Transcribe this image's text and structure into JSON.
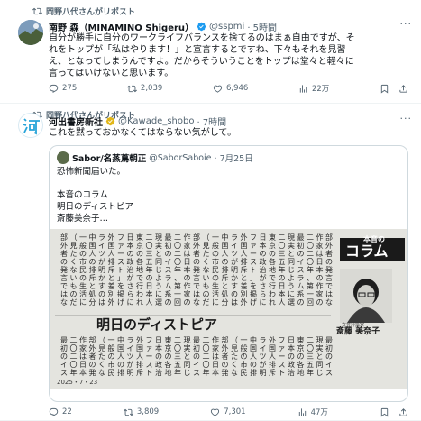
{
  "tweet1": {
    "repost_label": "岡野八代さんがリポスト",
    "author_name": "南野 森（MINAMINO Shigeru）",
    "handle": "@sspmi",
    "time": "· 5時間",
    "lines": [
      "自分が勝手に自分のワークライフバランスを捨てるのはまぁ自由ですが、そ",
      "れをトップが「私はやります！」と宣言するとですね、下々もそれを見習",
      "え、となってしまうんですよ。だからそういうことをトップは堂々と軽々に",
      "言ってはいけないと思います。"
    ],
    "replies": "275",
    "reposts": "2,039",
    "likes": "6,946",
    "views": "22万"
  },
  "tweet2": {
    "repost_label": "岡野八代さんがリポスト",
    "author_name": "河出書房新社",
    "handle": "@Kawade_shobo",
    "time": "· 7時間",
    "text": "これを黙っておかなくてはならない気がして。",
    "replies": "22",
    "reposts": "3,809",
    "likes": "7,301",
    "views": "47万"
  },
  "quote": {
    "author_name": "Sabor/名蒸蔦朝正",
    "handle": "@SaborSaboie",
    "time": "· 7月25日",
    "line1": "恐怖新聞届いた。",
    "line2": "本音のコラム",
    "line3": "明日のディストピア",
    "line4": "斎藤美奈子…"
  },
  "newspaper": {
    "kicker_main": "コラム",
    "kicker_top": "本音の",
    "headline": "明日のディストピア",
    "byline": "斎藤 美奈子",
    "byline_role": "文芸評論家",
    "date_stamp": "2025・7・23",
    "col_a": "部外者の発言ではない。作家の鏡だ",
    "col_b": "作家は日本の作家の一員だ",
    "col_c": "二〇二〇年、第一回参議院選挙",
    "col_d": "最初のイスラム系の議員",
    "col_e": "現実と同じように選挙",
    "col_f": "二〇三五年の日本人",
    "col_g": "東京の各地で行われる",
    "col_h": "日本の政治がさらに右",
    "col_i": "ファースト」を掲げて",
    "col_j": "外国人排斥と差別",
    "col_k": "ライツが明かすのは",
    "col_l": "中国人の排斥と処分",
    "col_m": "一般の市民の生活に",
    "col_n": "（見たくないものだ）"
  },
  "colors": {
    "accent": "#1d9bf0",
    "muted": "#536471",
    "kawade_logo": "#27a4d9"
  }
}
